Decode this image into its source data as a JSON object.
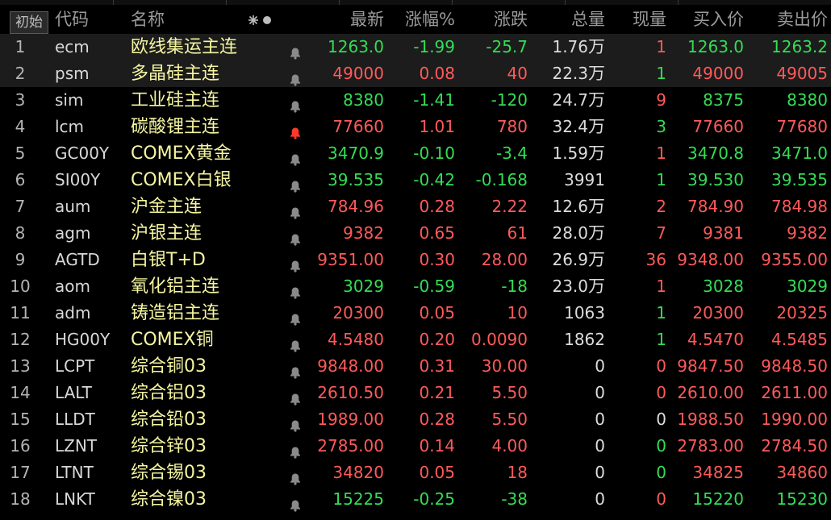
{
  "header": {
    "reset_label": "初始",
    "columns": {
      "code": "代码",
      "name": "称",
      "last": "最新",
      "pct": "涨幅%",
      "chg": "涨跌",
      "vol": "总量",
      "cur": "现量",
      "bid": "买入价",
      "ask": "卖出价"
    }
  },
  "colors": {
    "up": "#ff5a5a",
    "down": "#33dd55",
    "name": "#f5f5a0",
    "bell_active": "#ff3a2a"
  },
  "rows": [
    {
      "idx": "1",
      "code": "ecm",
      "name": "欧线集运主连",
      "bell": false,
      "last": "1263.0",
      "pct": "-1.99",
      "chg": "-25.7",
      "vol": "1.76",
      "vol_unit": "万",
      "cur": "1",
      "bid": "1263.0",
      "ask": "1263.2",
      "c_last": "dn",
      "c_pct": "dn",
      "c_chg": "dn",
      "c_cur": "up",
      "c_bid": "dn",
      "c_ask": "dn",
      "sel": true
    },
    {
      "idx": "2",
      "code": "psm",
      "name": "多晶硅主连",
      "bell": false,
      "last": "49000",
      "pct": "0.08",
      "chg": "40",
      "vol": "22.3",
      "vol_unit": "万",
      "cur": "1",
      "bid": "49000",
      "ask": "49005",
      "c_last": "up",
      "c_pct": "up",
      "c_chg": "up",
      "c_cur": "dn",
      "c_bid": "up",
      "c_ask": "up",
      "sel": true
    },
    {
      "idx": "3",
      "code": "sim",
      "name": "工业硅主连",
      "bell": false,
      "last": "8380",
      "pct": "-1.41",
      "chg": "-120",
      "vol": "24.7",
      "vol_unit": "万",
      "cur": "9",
      "bid": "8375",
      "ask": "8380",
      "c_last": "dn",
      "c_pct": "dn",
      "c_chg": "dn",
      "c_cur": "up",
      "c_bid": "dn",
      "c_ask": "dn"
    },
    {
      "idx": "4",
      "code": "lcm",
      "name": "碳酸锂主连",
      "bell": true,
      "last": "77660",
      "pct": "1.01",
      "chg": "780",
      "vol": "32.4",
      "vol_unit": "万",
      "cur": "3",
      "bid": "77660",
      "ask": "77680",
      "c_last": "up",
      "c_pct": "up",
      "c_chg": "up",
      "c_cur": "dn",
      "c_bid": "up",
      "c_ask": "up"
    },
    {
      "idx": "5",
      "code": "GC00Y",
      "name": "COMEX黄金",
      "bell": false,
      "last": "3470.9",
      "pct": "-0.10",
      "chg": "-3.4",
      "vol": "1.59",
      "vol_unit": "万",
      "cur": "1",
      "bid": "3470.8",
      "ask": "3471.0",
      "c_last": "dn",
      "c_pct": "dn",
      "c_chg": "dn",
      "c_cur": "up",
      "c_bid": "dn",
      "c_ask": "dn"
    },
    {
      "idx": "6",
      "code": "SI00Y",
      "name": "COMEX白银",
      "bell": false,
      "last": "39.535",
      "pct": "-0.42",
      "chg": "-0.168",
      "vol": "3991",
      "vol_unit": "",
      "cur": "1",
      "bid": "39.530",
      "ask": "39.535",
      "c_last": "dn",
      "c_pct": "dn",
      "c_chg": "dn",
      "c_cur": "dn",
      "c_bid": "dn",
      "c_ask": "dn"
    },
    {
      "idx": "7",
      "code": "aum",
      "name": "沪金主连",
      "bell": false,
      "last": "784.96",
      "pct": "0.28",
      "chg": "2.22",
      "vol": "12.6",
      "vol_unit": "万",
      "cur": "2",
      "bid": "784.90",
      "ask": "784.98",
      "c_last": "up",
      "c_pct": "up",
      "c_chg": "up",
      "c_cur": "up",
      "c_bid": "up",
      "c_ask": "up"
    },
    {
      "idx": "8",
      "code": "agm",
      "name": "沪银主连",
      "bell": false,
      "last": "9382",
      "pct": "0.65",
      "chg": "61",
      "vol": "28.0",
      "vol_unit": "万",
      "cur": "7",
      "bid": "9381",
      "ask": "9382",
      "c_last": "up",
      "c_pct": "up",
      "c_chg": "up",
      "c_cur": "up",
      "c_bid": "up",
      "c_ask": "up"
    },
    {
      "idx": "9",
      "code": "AGTD",
      "name": "白银T+D",
      "bell": false,
      "last": "9351.00",
      "pct": "0.30",
      "chg": "28.00",
      "vol": "26.9",
      "vol_unit": "万",
      "cur": "36",
      "bid": "9348.00",
      "ask": "9355.00",
      "c_last": "up",
      "c_pct": "up",
      "c_chg": "up",
      "c_cur": "up",
      "c_bid": "up",
      "c_ask": "up"
    },
    {
      "idx": "10",
      "code": "aom",
      "name": "氧化铝主连",
      "bell": false,
      "last": "3029",
      "pct": "-0.59",
      "chg": "-18",
      "vol": "23.0",
      "vol_unit": "万",
      "cur": "1",
      "bid": "3028",
      "ask": "3029",
      "c_last": "dn",
      "c_pct": "dn",
      "c_chg": "dn",
      "c_cur": "up",
      "c_bid": "dn",
      "c_ask": "dn"
    },
    {
      "idx": "11",
      "code": "adm",
      "name": "铸造铝主连",
      "bell": false,
      "last": "20300",
      "pct": "0.05",
      "chg": "10",
      "vol": "1063",
      "vol_unit": "",
      "cur": "1",
      "bid": "20300",
      "ask": "20325",
      "c_last": "up",
      "c_pct": "up",
      "c_chg": "up",
      "c_cur": "dn",
      "c_bid": "up",
      "c_ask": "up"
    },
    {
      "idx": "12",
      "code": "HG00Y",
      "name": "COMEX铜",
      "bell": false,
      "last": "4.5480",
      "pct": "0.20",
      "chg": "0.0090",
      "vol": "1862",
      "vol_unit": "",
      "cur": "1",
      "bid": "4.5470",
      "ask": "4.5485",
      "c_last": "up",
      "c_pct": "up",
      "c_chg": "up",
      "c_cur": "dn",
      "c_bid": "up",
      "c_ask": "up"
    },
    {
      "idx": "13",
      "code": "LCPT",
      "name": "综合铜03",
      "bell": false,
      "last": "9848.00",
      "pct": "0.31",
      "chg": "30.00",
      "vol": "0",
      "vol_unit": "",
      "cur": "0",
      "bid": "9847.50",
      "ask": "9848.50",
      "c_last": "up",
      "c_pct": "up",
      "c_chg": "up",
      "c_cur": "up",
      "c_bid": "up",
      "c_ask": "up"
    },
    {
      "idx": "14",
      "code": "LALT",
      "name": "综合铝03",
      "bell": false,
      "last": "2610.50",
      "pct": "0.21",
      "chg": "5.50",
      "vol": "0",
      "vol_unit": "",
      "cur": "0",
      "bid": "2610.00",
      "ask": "2611.00",
      "c_last": "up",
      "c_pct": "up",
      "c_chg": "up",
      "c_cur": "up",
      "c_bid": "up",
      "c_ask": "up"
    },
    {
      "idx": "15",
      "code": "LLDT",
      "name": "综合铅03",
      "bell": false,
      "last": "1989.00",
      "pct": "0.28",
      "chg": "5.50",
      "vol": "0",
      "vol_unit": "",
      "cur": "0",
      "bid": "1988.50",
      "ask": "1990.00",
      "c_last": "up",
      "c_pct": "up",
      "c_chg": "up",
      "c_cur": "flat",
      "c_bid": "up",
      "c_ask": "up"
    },
    {
      "idx": "16",
      "code": "LZNT",
      "name": "综合锌03",
      "bell": false,
      "last": "2785.00",
      "pct": "0.14",
      "chg": "4.00",
      "vol": "0",
      "vol_unit": "",
      "cur": "0",
      "bid": "2783.00",
      "ask": "2784.50",
      "c_last": "up",
      "c_pct": "up",
      "c_chg": "up",
      "c_cur": "dn",
      "c_bid": "up",
      "c_ask": "up"
    },
    {
      "idx": "17",
      "code": "LTNT",
      "name": "综合锡03",
      "bell": false,
      "last": "34820",
      "pct": "0.05",
      "chg": "18",
      "vol": "0",
      "vol_unit": "",
      "cur": "0",
      "bid": "34825",
      "ask": "34860",
      "c_last": "up",
      "c_pct": "up",
      "c_chg": "up",
      "c_cur": "dn",
      "c_bid": "up",
      "c_ask": "up"
    },
    {
      "idx": "18",
      "code": "LNKT",
      "name": "综合镍03",
      "bell": false,
      "last": "15225",
      "pct": "-0.25",
      "chg": "-38",
      "vol": "0",
      "vol_unit": "",
      "cur": "0",
      "bid": "15220",
      "ask": "15230",
      "c_last": "dn",
      "c_pct": "dn",
      "c_chg": "dn",
      "c_cur": "up",
      "c_bid": "dn",
      "c_ask": "dn"
    }
  ]
}
